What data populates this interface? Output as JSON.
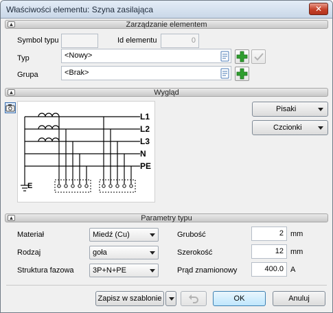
{
  "window": {
    "title": "Właściwości elementu: Szyna zasilająca",
    "close_glyph": "✕"
  },
  "sections": {
    "management": "Zarządzanie elementem",
    "appearance": "Wygląd",
    "params": "Parametry typu"
  },
  "management": {
    "symbol_label": "Symbol typu",
    "symbol_value": "",
    "id_label": "Id elementu",
    "id_value": "0",
    "type_label": "Typ",
    "type_value": "<Nowy>",
    "group_label": "Grupa",
    "group_value": "<Brak>"
  },
  "appearance": {
    "pens_button": "Pisaki",
    "fonts_button": "Czcionki",
    "diagram_labels": [
      "L1",
      "L2",
      "L3",
      "N",
      "PE"
    ],
    "ground_label": "E"
  },
  "params": {
    "material_label": "Materiał",
    "material_value": "Miedź (Cu)",
    "kind_label": "Rodzaj",
    "kind_value": "goła",
    "structure_label": "Struktura fazowa",
    "structure_value": "3P+N+PE",
    "thickness_label": "Grubość",
    "thickness_value": "2",
    "thickness_unit": "mm",
    "width_label": "Szerokość",
    "width_value": "12",
    "width_unit": "mm",
    "current_label": "Prąd znamionowy",
    "current_value": "400.0",
    "current_unit": "A"
  },
  "footer": {
    "save_template": "Zapisz w szablonie",
    "ok": "OK",
    "cancel": "Anuluj"
  },
  "colors": {
    "accent_green": "#2f9e2f",
    "title_bg": "#c9d7e8",
    "close_red": "#c5412a"
  }
}
